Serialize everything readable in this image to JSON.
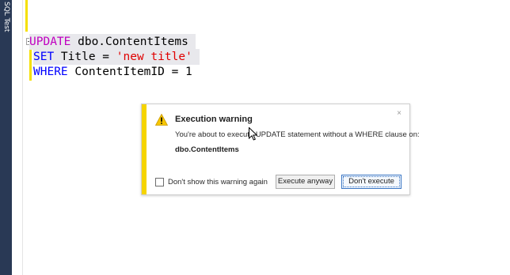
{
  "side_tab": {
    "label": "SQL Test"
  },
  "editor": {
    "line1": {
      "keyword": "UPDATE",
      "rest": " dbo.ContentItems "
    },
    "line2": {
      "keyword": "SET",
      "mid": " Title = ",
      "string": "'new title'",
      "tail": " "
    },
    "line3": {
      "keyword": "WHERE",
      "rest": " ContentItemID = 1"
    }
  },
  "dialog": {
    "title": "Execution warning",
    "close": "×",
    "message": "You're about to execute   UPDATE statement without a WHERE clause on:",
    "object": "dbo.ContentItems",
    "checkbox_label": "Don't show this warning again",
    "execute_anyway": "Execute anyway",
    "dont_execute": "Don't execute"
  },
  "colors": {
    "side_strip": "#293955",
    "change_bar": "#f5e000",
    "dialog_accent": "#f5d400",
    "keyword_magenta": "#c000c0",
    "keyword_blue": "#0000ff",
    "string_red": "#e00000"
  },
  "icons": [
    "warning-icon",
    "close-icon",
    "mouse-cursor-icon",
    "collapse-icon"
  ]
}
